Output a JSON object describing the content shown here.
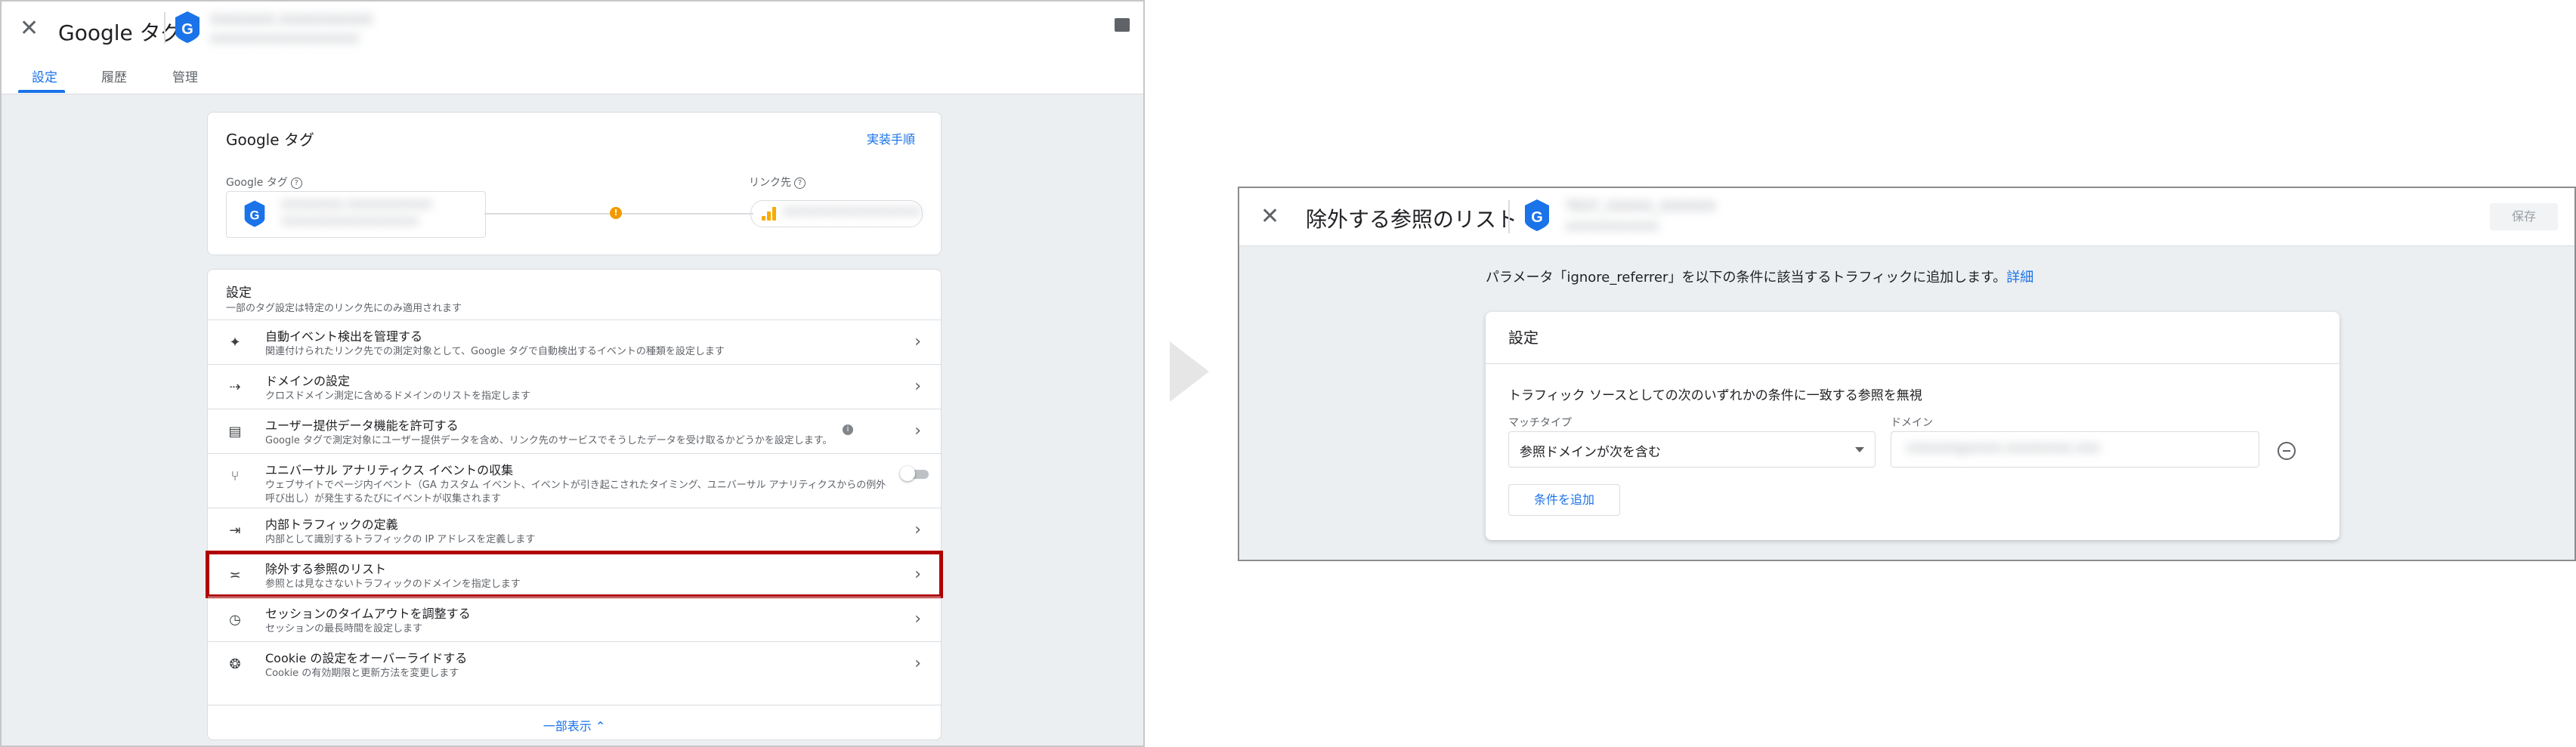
{
  "left": {
    "header": {
      "title": "Google タグ",
      "account_line1": "XXXXXXX.XXXXXXXXXX",
      "account_line2": "XXXXXXXXXXXXXXXXXX"
    },
    "tabs": [
      "設定",
      "履歴",
      "管理"
    ],
    "gtag_card": {
      "title": "Google タグ",
      "implementation_link": "実装手順",
      "tag_label": "Google タグ",
      "link_label": "リンク先",
      "tag_line1": "XXXXXXXX.XXXXXXXXXXX",
      "tag_line2": "XXXXXXXXXXXXXXXXXXX",
      "link_line1": "XXXXXXXXXXXXXXXXXXX",
      "connector_alert": "!"
    },
    "settings_card": {
      "title": "設定",
      "subtitle": "一部のタグ設定は特定のリンク先にのみ適用されます",
      "rows": [
        {
          "icon": "✦",
          "title": "自動イベント検出を管理する",
          "desc": "関連付けられたリンク先での測定対象として、Google タグで自動検出するイベントの種類を設定します"
        },
        {
          "icon": "⇢",
          "title": "ドメインの設定",
          "desc": "クロスドメイン測定に含めるドメインのリストを指定します"
        },
        {
          "icon": "▤",
          "title": "ユーザー提供データ機能を許可する",
          "desc": "Google タグで測定対象にユーザー提供データを含め、リンク先のサービスでそうしたデータを受け取るかどうかを設定します。",
          "info": "i"
        },
        {
          "icon": "⑂",
          "title": "ユニバーサル アナリティクス イベントの収集",
          "desc": "ウェブサイトでページ内イベント（GA カスタム イベント、イベントが引き起こされたタイミング、ユニバーサル アナリティクスからの例外",
          "desc2": "呼び出し）が発生するたびにイベントが収集されます"
        },
        {
          "icon": "⇥",
          "title": "内部トラフィックの定義",
          "desc": "内部として識別するトラフィックの IP アドレスを定義します"
        },
        {
          "icon": "≍",
          "title": "除外する参照のリスト",
          "desc": "参照とは見なさないトラフィックのドメインを指定します"
        },
        {
          "icon": "◷",
          "title": "セッションのタイムアウトを調整する",
          "desc": "セッションの最長時間を設定します"
        },
        {
          "icon": "❂",
          "title": "Cookie の設定をオーバーライドする",
          "desc": "Cookie の有効期限と更新方法を変更します"
        }
      ],
      "show_less": "一部表示 ⌃"
    }
  },
  "right": {
    "header": {
      "title": "除外する参照のリスト",
      "account_line1": "TEST_XXXXX_XXXXXX",
      "account_line2": "XXXXXXXXXXXX",
      "save_label": "保存"
    },
    "intro_text": "パラメータ「ignore_referrer」を以下の条件に該当するトラフィックに追加します。",
    "intro_link": "詳細",
    "card": {
      "title": "設定",
      "rule": "トラフィック ソースとしての次のいずれかの条件に一致する参照を無視",
      "match_label": "マッチタイプ",
      "match_value": "参照ドメインが次を含む",
      "domain_label": "ドメイン",
      "domain_value": "XXXXXX@XXXX.XXXXXXXX.XXX",
      "add_condition": "条件を追加"
    }
  },
  "colors": {
    "accent": "#1a73e8",
    "highlight": "#b00000",
    "analytics_orange": "#f9ab00"
  }
}
